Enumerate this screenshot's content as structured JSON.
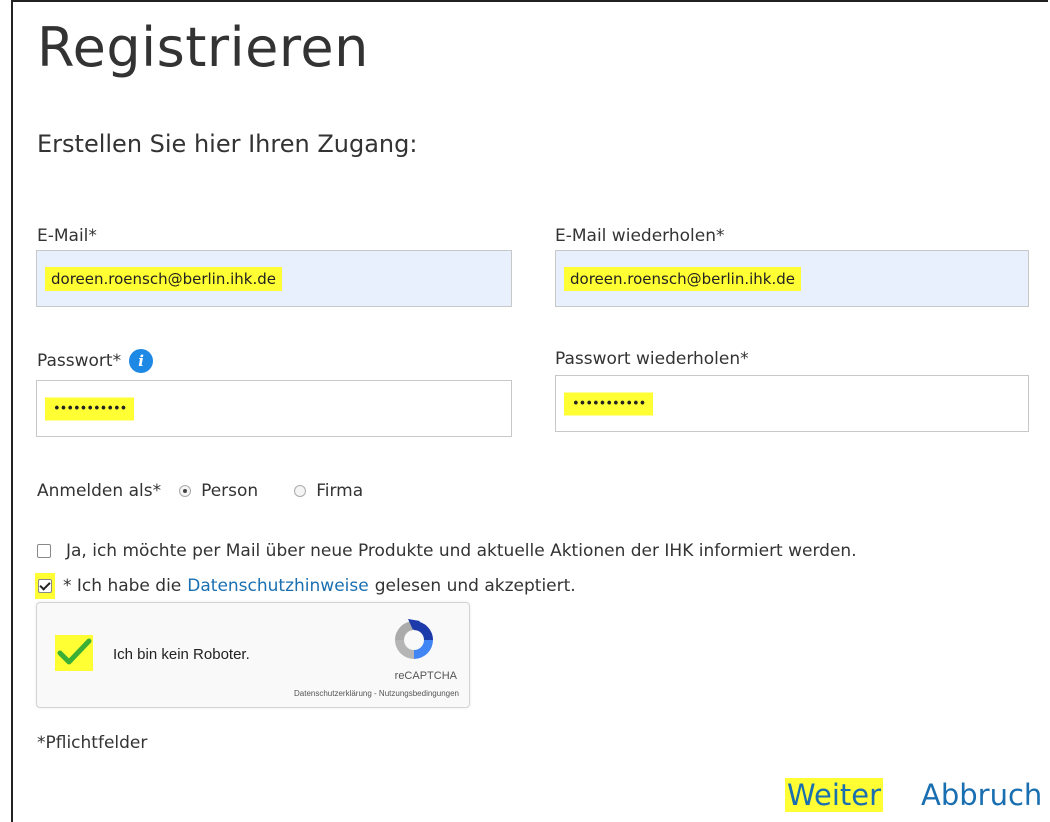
{
  "page": {
    "title": "Registrieren",
    "subtitle": "Erstellen Sie hier Ihren Zugang:"
  },
  "form": {
    "email_label": "E-Mail*",
    "email_value": "doreen.roensch@berlin.ihk.de",
    "email_repeat_label": "E-Mail wiederholen*",
    "email_repeat_value": "doreen.roensch@berlin.ihk.de",
    "password_label": "Passwort*",
    "password_value": "•••••••••••",
    "password_repeat_label": "Passwort wiederholen*",
    "password_repeat_value": "•••••••••••",
    "register_as_label": "Anmelden als*",
    "register_options": [
      "Person",
      "Firma"
    ],
    "register_selected": "Person",
    "newsletter_label": "Ja, ich möchte per Mail über neue Produkte und aktuelle Aktionen der IHK informiert werden.",
    "newsletter_checked": false,
    "privacy_prefix": "* Ich habe die",
    "privacy_link": "Datenschutzhinweise",
    "privacy_suffix": "gelesen und akzeptiert.",
    "privacy_checked": true,
    "required_note": "*Pflichtfelder"
  },
  "captcha": {
    "label": "Ich bin kein Roboter.",
    "brand": "reCAPTCHA",
    "footer": "Datenschutzerklärung - Nutzungsbedingungen",
    "checked": true
  },
  "actions": {
    "next_label": "Weiter",
    "cancel_label": "Abbruch"
  },
  "icons": {
    "info": "info-icon",
    "recaptcha": "recaptcha-logo-icon",
    "check": "checkmark-icon"
  },
  "colors": {
    "highlight": "#ffff33",
    "link": "#1a6fb0",
    "info": "#1e88e5",
    "autofill": "#e8f0fe",
    "check_green": "#3cb034"
  }
}
